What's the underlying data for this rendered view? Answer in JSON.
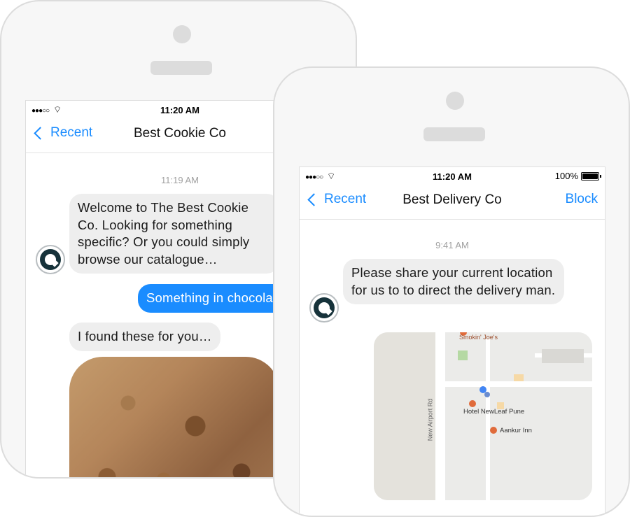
{
  "left_phone": {
    "status": {
      "signal": "●●●○○",
      "time": "11:20 AM"
    },
    "nav": {
      "back_label": "Recent",
      "title": "Best Cookie Co"
    },
    "chat": {
      "timestamp": "11:19 AM",
      "messages": [
        {
          "from": "bot",
          "text": "Welcome to The Best Cookie Co. Looking for something specific? Or you could simply browse our catalogue…"
        },
        {
          "from": "user",
          "text": "Something in chocolate"
        },
        {
          "from": "bot",
          "text": "I found these for you…"
        }
      ],
      "image": "cookies-photo"
    }
  },
  "right_phone": {
    "status": {
      "signal": "●●●○○",
      "time": "11:20 AM",
      "battery": "100%"
    },
    "nav": {
      "back_label": "Recent",
      "title": "Best Delivery Co",
      "action_label": "Block"
    },
    "chat": {
      "timestamp": "9:41 AM",
      "messages": [
        {
          "from": "bot",
          "text": "Please share your current location for us to to direct the delivery man."
        }
      ],
      "map": {
        "labels": {
          "smokin": "Smokin' Joe's",
          "hotel": "Hotel NewLeaf Pune",
          "aankur": "Aankur Inn",
          "road": "New Airport Rd"
        }
      }
    }
  },
  "colors": {
    "accent": "#1a8cff",
    "bubble_in": "#eeeeee",
    "avatar": "#16323a"
  }
}
